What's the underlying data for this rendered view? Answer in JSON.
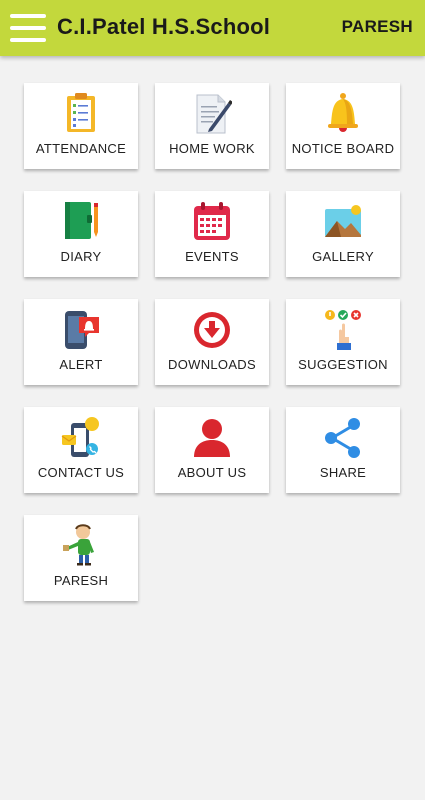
{
  "appbar": {
    "title": "C.I.Patel H.S.School",
    "user": "PARESH",
    "color": "#c3d83c"
  },
  "menu": {
    "icon": "hamburger-menu-icon"
  },
  "tiles": [
    {
      "label": "ATTENDANCE",
      "icon": "clipboard-checklist-icon"
    },
    {
      "label": "HOME WORK",
      "icon": "document-pen-icon"
    },
    {
      "label": "NOTICE BOARD",
      "icon": "bell-icon"
    },
    {
      "label": "DIARY",
      "icon": "notebook-icon"
    },
    {
      "label": "EVENTS",
      "icon": "calendar-icon"
    },
    {
      "label": "GALLERY",
      "icon": "picture-icon"
    },
    {
      "label": "ALERT",
      "icon": "phone-notification-icon"
    },
    {
      "label": "DOWNLOADS",
      "icon": "download-icon"
    },
    {
      "label": "SUGGESTION",
      "icon": "feedback-icon"
    },
    {
      "label": "CONTACT US",
      "icon": "contact-phone-icon"
    },
    {
      "label": "ABOUT US",
      "icon": "user-icon"
    },
    {
      "label": "SHARE",
      "icon": "share-icon"
    },
    {
      "label": "PARESH",
      "icon": "profile-cartoon-icon"
    }
  ]
}
